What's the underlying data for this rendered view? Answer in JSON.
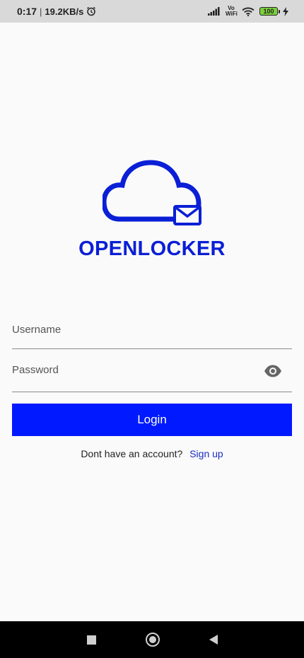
{
  "status_bar": {
    "time": "0:17",
    "speed": "19.2KB/s",
    "network_label": "Vo WiFi",
    "battery": "100"
  },
  "app": {
    "brand": "OPENLOCKER",
    "colors": {
      "primary": "#0019ff",
      "brand_text": "#0a1fd6",
      "link": "#1b2dbf"
    }
  },
  "form": {
    "username_label": "Username",
    "password_label": "Password",
    "login_label": "Login",
    "signup_prompt": "Dont have an account?",
    "signup_link": "Sign up"
  },
  "icons": [
    "alarm-icon",
    "signal-icon",
    "wifi-icon",
    "battery-icon",
    "charging-icon",
    "cloud-mail-logo-icon",
    "eye-icon",
    "nav-recents-icon",
    "nav-home-icon",
    "nav-back-icon"
  ]
}
